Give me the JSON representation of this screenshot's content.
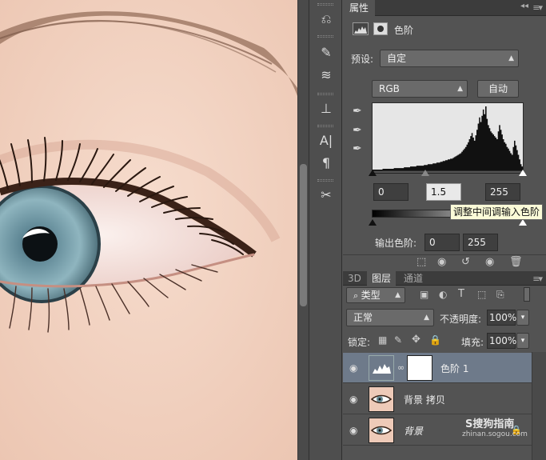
{
  "properties": {
    "tab_label": "属性",
    "adjustment_name": "色阶",
    "preset_label": "预设:",
    "preset_value": "自定",
    "channel_value": "RGB",
    "auto_button": "自动",
    "input_black": "0",
    "input_gamma": "1.5",
    "input_white": "255",
    "tooltip": "调整中间调输入色阶",
    "output_label": "输出色阶:",
    "output_black": "0",
    "output_white": "255"
  },
  "layers_panel": {
    "tabs": [
      "3D",
      "图层",
      "通道"
    ],
    "filter_kind": "类型",
    "blend_mode": "正常",
    "opacity_label": "不透明度:",
    "opacity_value": "100%",
    "lock_label": "锁定:",
    "fill_label": "填充:",
    "fill_value": "100%",
    "layers": [
      {
        "name": "色阶 1",
        "selected": true,
        "type": "adjustment"
      },
      {
        "name": "背景 拷贝",
        "selected": false,
        "type": "image"
      },
      {
        "name": "背景",
        "selected": false,
        "type": "image",
        "locked": true
      }
    ]
  },
  "watermark": {
    "brand": "S搜狗指南",
    "url": "zhinan.sogou.com"
  },
  "histogram_shape": [
    1,
    1,
    1,
    1,
    1,
    1,
    1,
    1,
    2,
    2,
    2,
    2,
    2,
    2,
    2,
    2,
    2,
    3,
    3,
    3,
    3,
    3,
    3,
    3,
    3,
    4,
    4,
    4,
    4,
    4,
    5,
    5,
    5,
    5,
    5,
    6,
    6,
    6,
    6,
    6,
    6,
    7,
    7,
    7,
    8,
    8,
    8,
    8,
    9,
    9,
    9,
    10,
    10,
    10,
    11,
    11,
    12,
    12,
    13,
    13,
    14,
    14,
    15,
    15,
    16,
    17,
    18,
    19,
    20,
    21,
    22,
    24,
    26,
    28,
    30,
    33,
    36,
    40,
    44,
    48,
    42,
    38,
    45,
    52,
    60,
    68,
    62,
    70,
    78,
    72,
    82,
    66,
    58,
    54,
    50,
    48,
    46,
    44,
    42,
    40,
    50,
    58,
    52,
    46,
    40,
    36,
    34,
    30,
    28,
    25,
    22,
    20,
    30,
    38,
    32,
    26,
    20,
    14,
    8,
    5
  ]
}
